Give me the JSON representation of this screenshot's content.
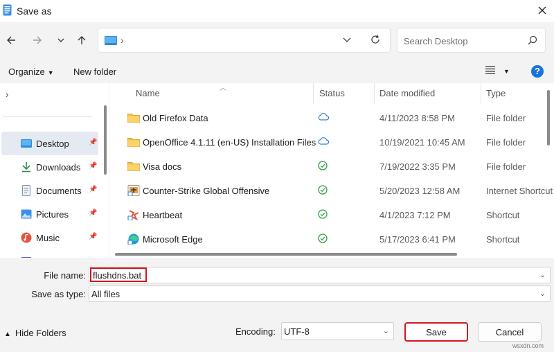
{
  "window": {
    "title": "Save as"
  },
  "search": {
    "placeholder": "Search Desktop"
  },
  "address": {
    "separator": "›"
  },
  "commandbar": {
    "organize_label": "Organize",
    "new_folder_label": "New folder",
    "help_label": "?"
  },
  "nav_pane": {
    "items": [
      {
        "label": "Desktop",
        "icon": "desktop-icon",
        "pinned": true,
        "selected": true
      },
      {
        "label": "Downloads",
        "icon": "download-icon",
        "pinned": true
      },
      {
        "label": "Documents",
        "icon": "documents-icon",
        "pinned": true
      },
      {
        "label": "Pictures",
        "icon": "pictures-icon",
        "pinned": true
      },
      {
        "label": "Music",
        "icon": "music-icon",
        "pinned": true
      },
      {
        "label": "Vi",
        "icon": "videos-icon",
        "pinned": true
      }
    ]
  },
  "columns": {
    "name": "Name",
    "status": "Status",
    "date_modified": "Date modified",
    "type": "Type"
  },
  "files": [
    {
      "name": "Old Firefox Data",
      "status": "cloud",
      "date": "4/11/2023 8:58 PM",
      "type": "File folder",
      "icon": "folder-icon"
    },
    {
      "name": "OpenOffice 4.1.11 (en-US) Installation Files",
      "status": "cloud",
      "date": "10/19/2021 10:45 AM",
      "type": "File folder",
      "icon": "folder-icon"
    },
    {
      "name": "Visa docs",
      "status": "synced",
      "date": "7/19/2022 3:35 PM",
      "type": "File folder",
      "icon": "folder-icon"
    },
    {
      "name": "Counter-Strike Global Offensive",
      "status": "synced",
      "date": "5/20/2023 12:58 AM",
      "type": "Internet Shortcut",
      "icon": "csgo-shortcut-icon"
    },
    {
      "name": "Heartbeat",
      "status": "synced",
      "date": "4/1/2023 7:12 PM",
      "type": "Shortcut",
      "icon": "heartbeat-shortcut-icon"
    },
    {
      "name": "Microsoft Edge",
      "status": "synced",
      "date": "5/17/2023 6:41 PM",
      "type": "Shortcut",
      "icon": "edge-icon"
    }
  ],
  "form": {
    "file_name_label": "File name:",
    "file_name_value": "flushdns.bat",
    "save_as_type_label": "Save as type:",
    "save_as_type_value": "All files",
    "encoding_label": "Encoding:",
    "encoding_value": "UTF-8",
    "hide_folders_label": "Hide Folders",
    "save_label": "Save",
    "cancel_label": "Cancel"
  },
  "watermark": "wsxdn.com",
  "colors": {
    "accent": "#1a73d9",
    "highlight": "#d7141f",
    "folder": "#f3c04d",
    "synced": "#2e9e44",
    "cloud": "#2b7cd3"
  }
}
